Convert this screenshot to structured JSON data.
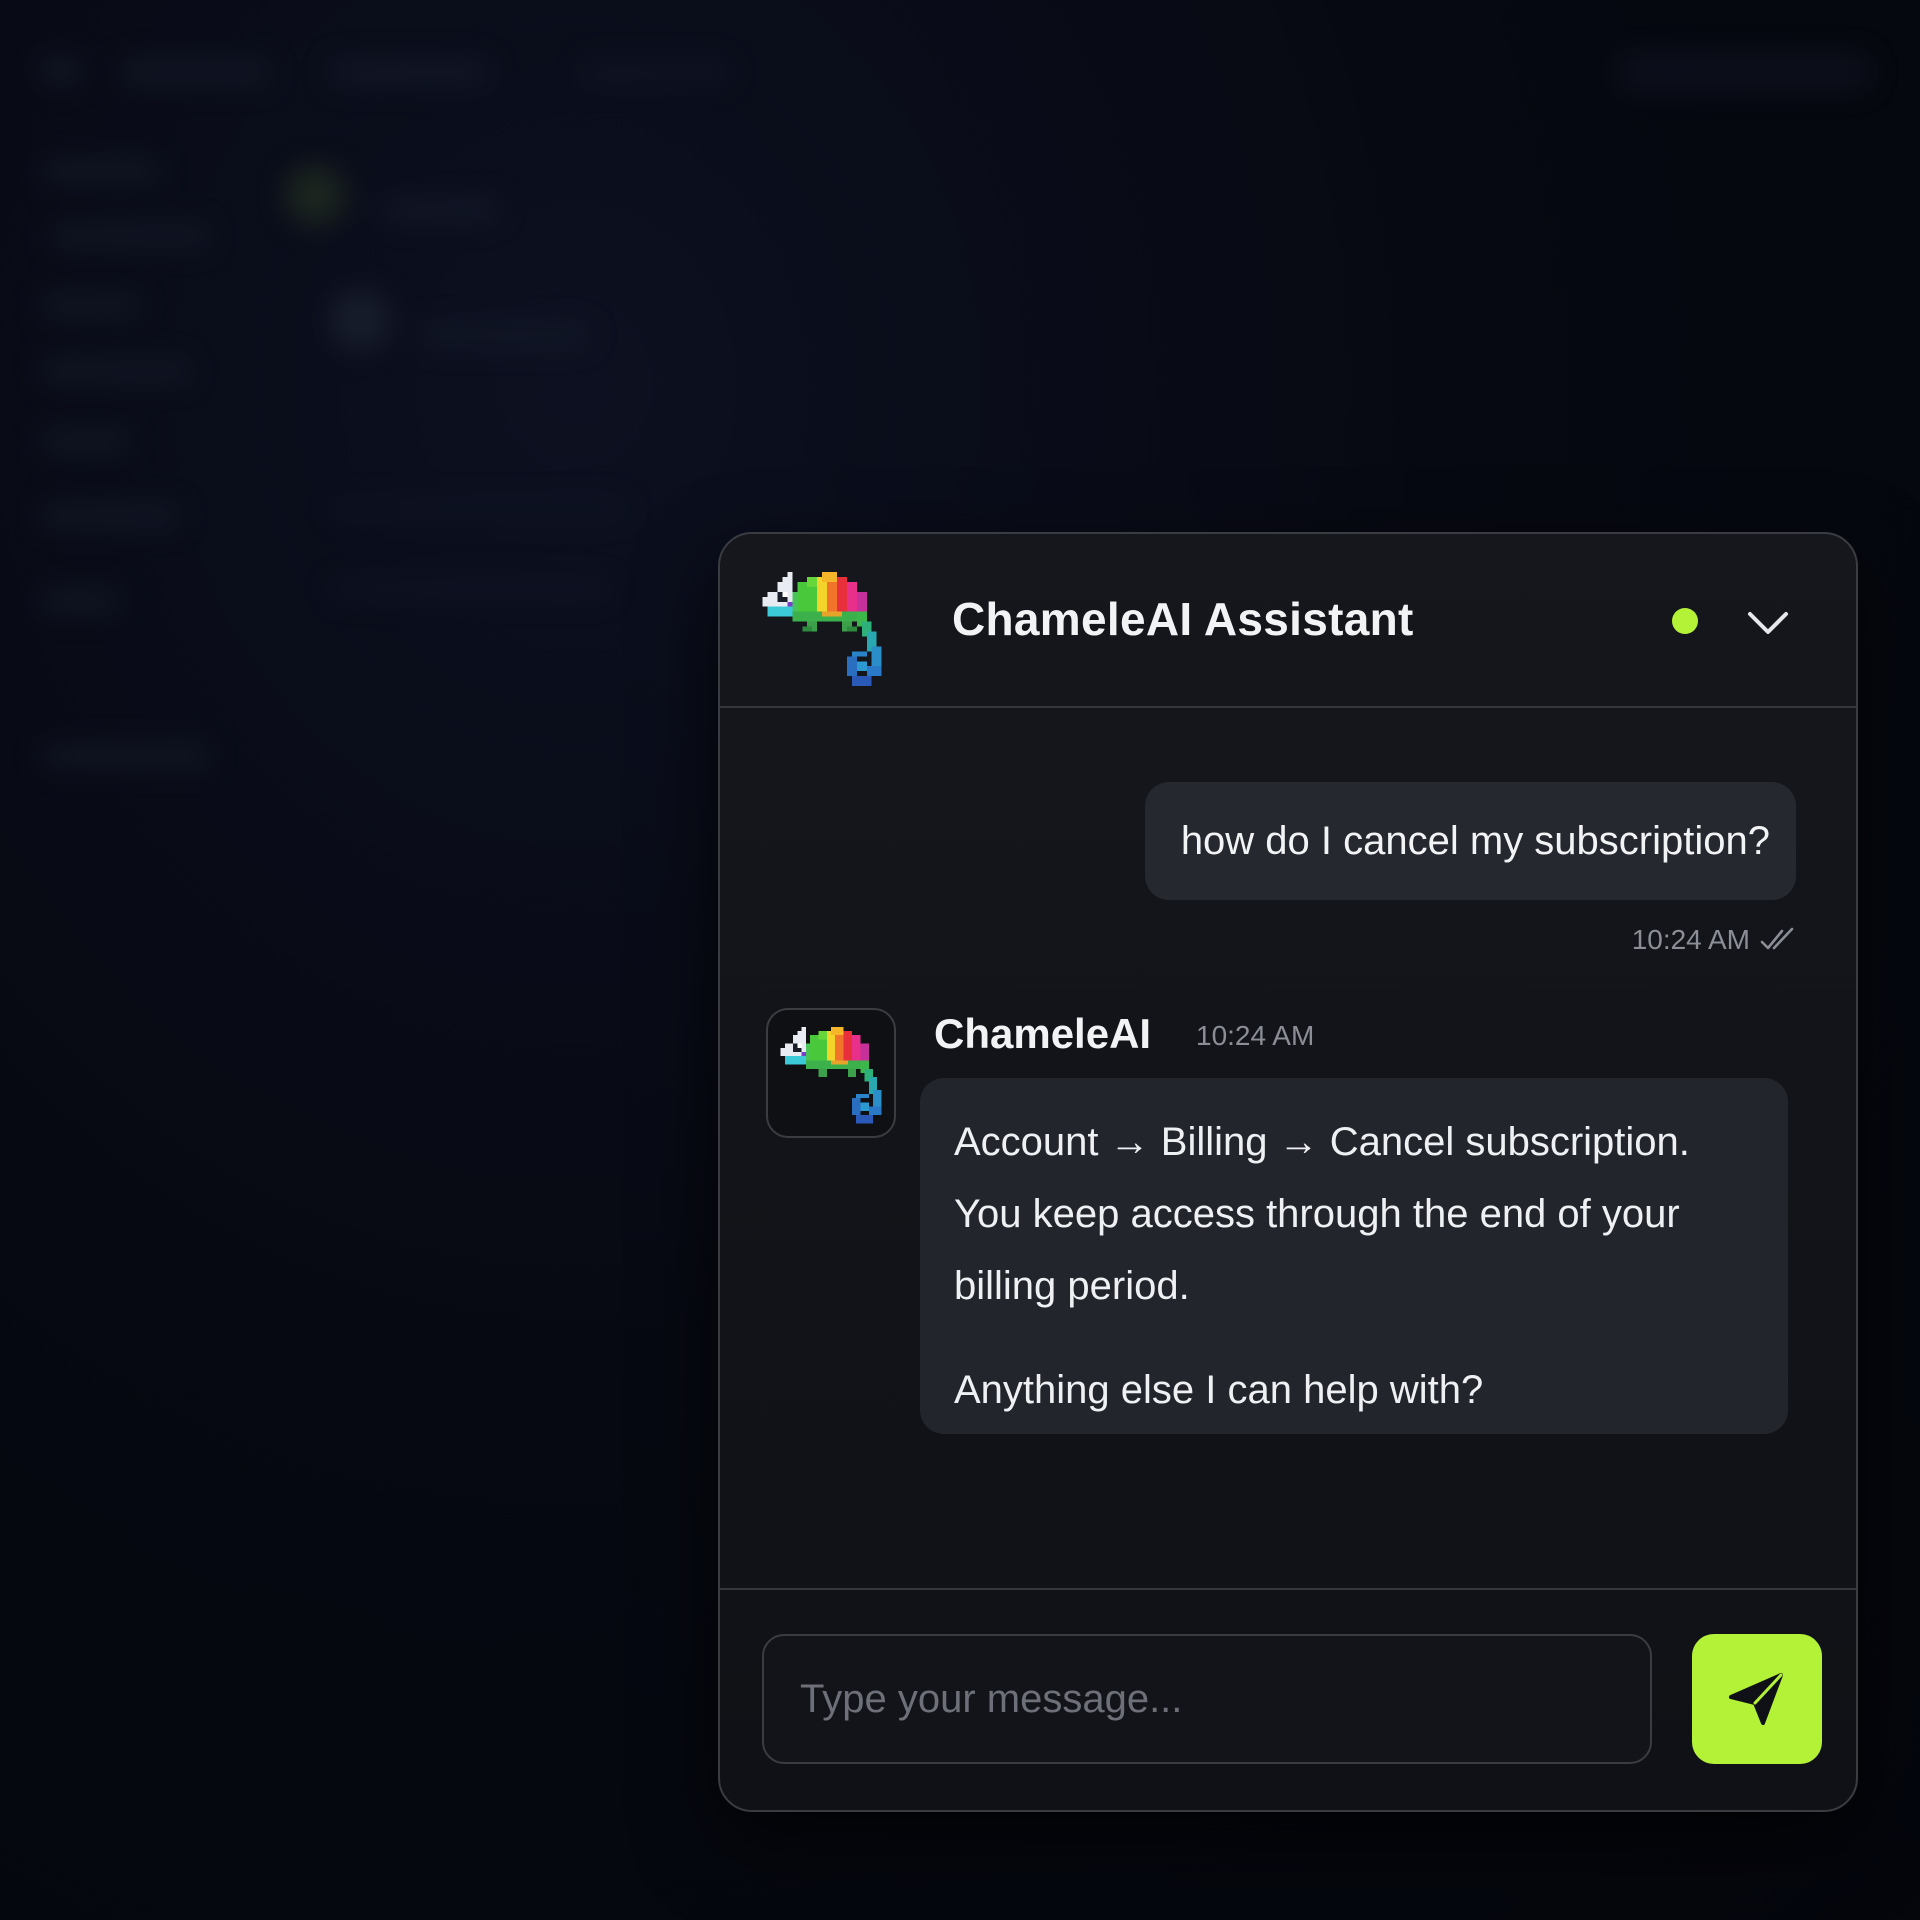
{
  "widget": {
    "title": "ChameleAI Assistant",
    "status": "online",
    "status_color": "#b4f238",
    "accent_color": "#b4f238",
    "icons": {
      "logo": "chameleon-pixel-logo-icon",
      "collapse": "chevron-down-icon",
      "read_receipt": "double-check-icon",
      "send": "paper-plane-icon"
    }
  },
  "messages": {
    "user": {
      "text": "how do I cancel my subscription?",
      "time": "10:24 AM"
    },
    "bot": {
      "name": "ChameleAI",
      "time": "10:24 AM",
      "paragraph_1": "Account → Billing → Cancel subscription. You keep access through the end of your billing period.",
      "paragraph_2": "Anything else I can help with?"
    }
  },
  "composer": {
    "placeholder": "Type your message...",
    "value": ""
  }
}
